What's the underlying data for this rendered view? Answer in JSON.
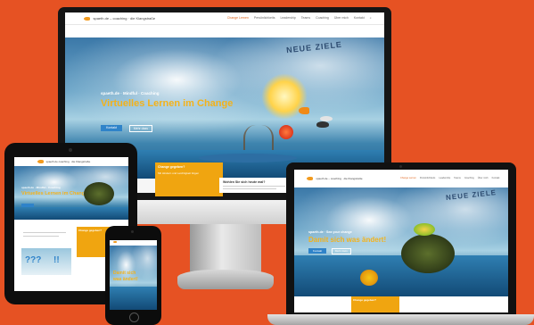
{
  "brand": {
    "logo_text": "spaeth.de – coaching · die Klangstraße",
    "accent_color": "#e65223",
    "headline_color": "#f3b21b",
    "button_color": "#2f83c9"
  },
  "desktop": {
    "nav": [
      "Change Lernen",
      "Persönlichkeits",
      "Leadership",
      "Teams",
      "Coaching",
      "Über mich",
      "Kontakt"
    ],
    "search_icon": "⌕",
    "kicker": "spaeth.de · Mindful · Coaching",
    "headline": "Virtuelles Lernen im Change",
    "button_primary": "Kontakt",
    "button_secondary": "Mehr dazu",
    "sign_text": "NEUE ZIELE"
  },
  "tablet": {
    "logo_text": "spaeth.de coaching · die Klangstraße",
    "kicker": "spaeth.de · Mindful · Coaching",
    "headline": "Virtuelles Lernen im Change",
    "card_orange_title": "Change gegeben?",
    "card_orange_text": "Mit Hindern und Leichtigkeit folgen",
    "card_white_title": "Wohlen Sie sich heute mal?",
    "question_marks": "???",
    "exclaim": "!!",
    "lower_card_title": "Change gegeben?"
  },
  "laptop": {
    "nav": [
      "Change Lernen",
      "Persönlichkeits",
      "Leadership",
      "Teams",
      "Coaching",
      "Über mich",
      "Kontakt"
    ],
    "kicker": "spaeth.de · Sea your change",
    "headline": "Damit sich was ändert!",
    "button_primary": "Kontakt",
    "button_secondary": "Mehr dazu",
    "sign_text": "NEUE ZIELE",
    "bottom_card_title": "Change gegeben?"
  },
  "phone": {
    "headline_line1": "Damit sich",
    "headline_line2": "was ändert!"
  }
}
